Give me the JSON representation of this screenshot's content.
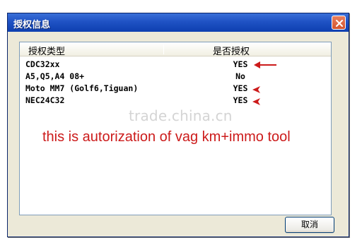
{
  "window": {
    "title": "授权信息",
    "close_icon": "close-icon"
  },
  "list": {
    "columns": [
      "授权类型",
      "是否授权"
    ],
    "rows": [
      {
        "name": "CDC32xx",
        "authorized": "YES",
        "marked": true
      },
      {
        "name": "A5,Q5,A4 08+",
        "authorized": "No",
        "marked": false
      },
      {
        "name": "Moto MM7 (Golf6,Tiguan)",
        "authorized": "YES",
        "marked": true
      },
      {
        "name": "NEC24C32",
        "authorized": "YES",
        "marked": true
      }
    ]
  },
  "overlay": {
    "watermark": "trade.china.cn",
    "caption": "this is autorization of vag km+immo tool"
  },
  "buttons": {
    "cancel_label": "取消"
  },
  "colors": {
    "titlebar": "#1f52c4",
    "dialog_bg": "#ece9d8",
    "annotation_red": "#cc1b1b",
    "watermark_gray": "#d4d4d4"
  }
}
